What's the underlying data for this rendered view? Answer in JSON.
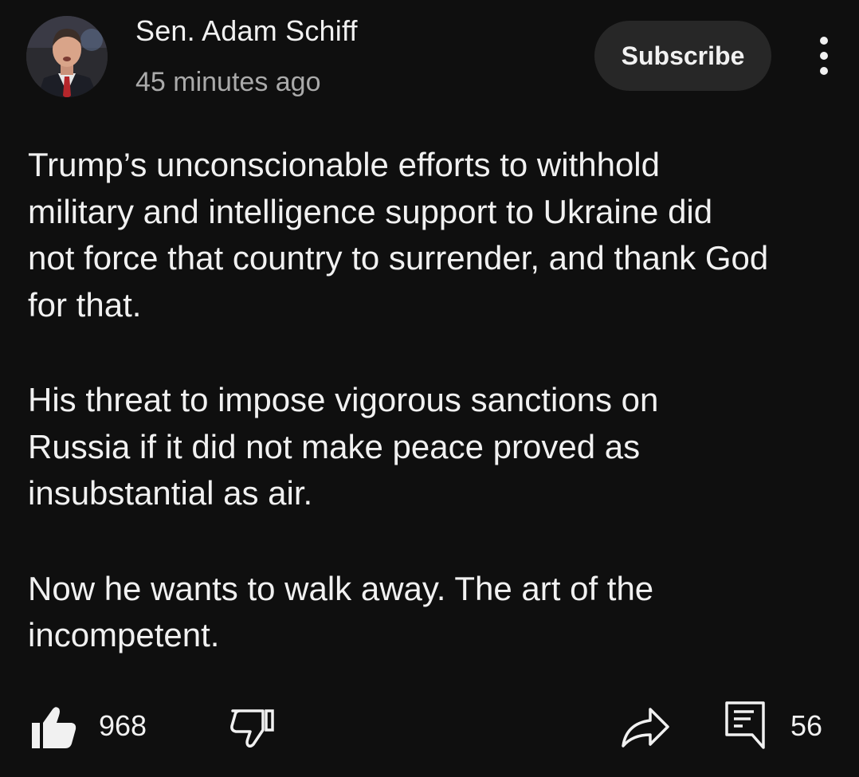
{
  "post": {
    "author": "Sen. Adam Schiff",
    "timestamp": "45 minutes ago",
    "subscribe_label": "Subscribe",
    "paragraphs": [
      "Trump’s unconscionable efforts to withhold\nmilitary and intelligence support to Ukraine did\nnot force that country to surrender, and thank God\nfor that.",
      "His threat to impose vigorous sanctions on\nRussia if it did not make peace proved as\ninsubstantial as air.",
      "Now he wants to walk away. The art of the\nincompetent."
    ],
    "likes": "968",
    "comments": "56"
  },
  "icons": {
    "like": "thumbs-up-filled-icon",
    "dislike": "thumbs-down-outline-icon",
    "share": "share-arrow-icon",
    "comments": "comment-icon",
    "more": "more-vertical-icon"
  },
  "colors": {
    "background": "#0f0f0f",
    "text_primary": "#f1f1f1",
    "text_secondary": "#aaaaaa",
    "subscribe_bg": "#272727"
  }
}
